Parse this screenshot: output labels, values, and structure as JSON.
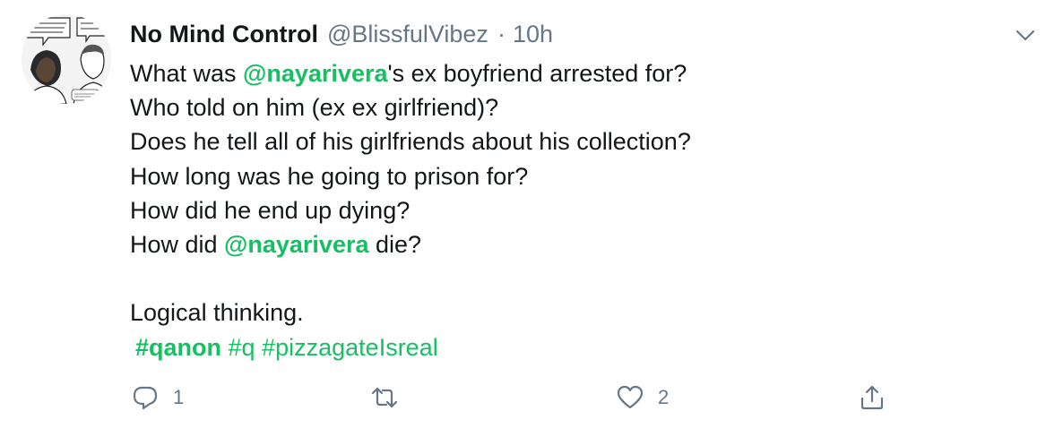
{
  "tweet": {
    "display_name": "No Mind Control",
    "handle": "@BlissfulVibez",
    "separator": "·",
    "time": "10h",
    "lines": {
      "l1_pre": "What was ",
      "l1_mention": "@nayarivera",
      "l1_post": "'s ex boyfriend arrested for?",
      "l2": "Who told on him (ex ex girlfriend)?",
      "l3": "Does he tell all of his girlfriends about his collection?",
      "l4": "How long was he going to prison for?",
      "l5": "How did he end up dying?",
      "l6_pre": "How did ",
      "l6_mention": "@nayarivera",
      "l6_post": " die?",
      "l8": "Logical thinking."
    },
    "hashtags": [
      "#qanon",
      "#q",
      "#pizzagateIsreal"
    ],
    "actions": {
      "reply_count": "1",
      "retweet_count": "",
      "like_count": "2"
    },
    "avatar_text": {
      "bubble_left": "NEVER JUDGED BY YOUR SKIN COLOR",
      "bubble_right": "WA..."
    }
  },
  "colors": {
    "accent": "#17bf63",
    "muted": "#657786",
    "text": "#14171a"
  },
  "icons": {
    "reply": "reply-icon",
    "retweet": "retweet-icon",
    "like": "heart-icon",
    "share": "share-icon",
    "caret": "chevron-down-icon"
  }
}
